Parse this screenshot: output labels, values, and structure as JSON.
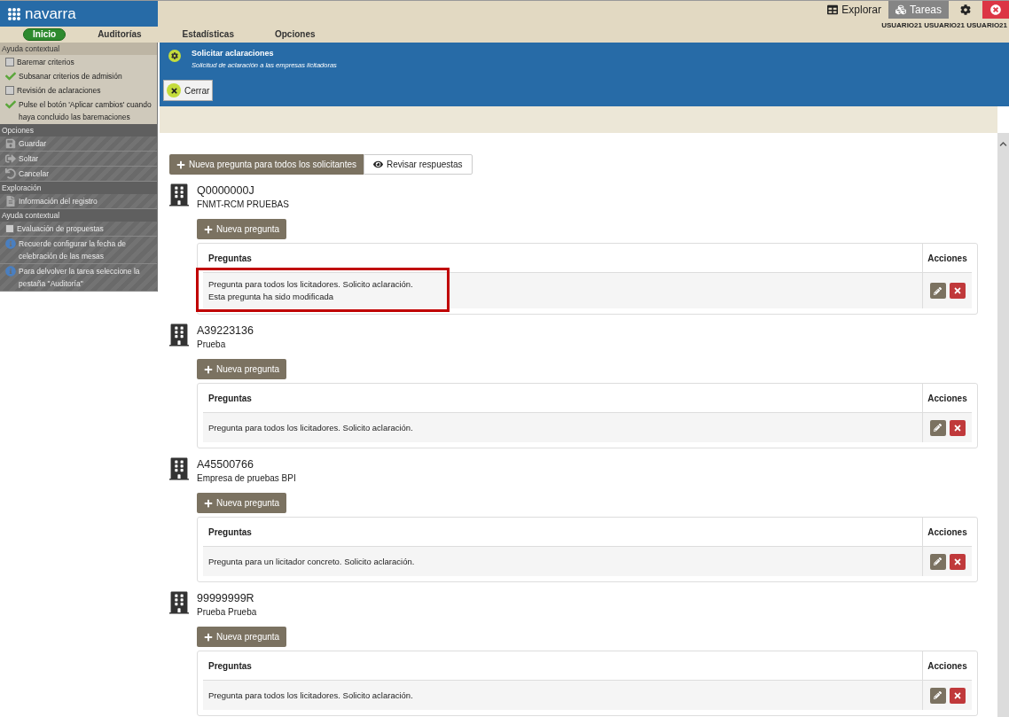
{
  "app": {
    "logo": "navarra"
  },
  "nav": [
    {
      "label": "Inicio",
      "selected": true
    },
    {
      "label": "Auditorías",
      "selected": false
    },
    {
      "label": "Estadísticas",
      "selected": false
    },
    {
      "label": "Opciones",
      "selected": false
    }
  ],
  "top_actions": [
    {
      "label": "Explorar",
      "kind": "explore",
      "selected": false
    },
    {
      "label": "Tareas",
      "kind": "tasks",
      "selected": true
    }
  ],
  "users": "USUARIO21 USUARIO21 USUARIO21",
  "sidebar": [
    {
      "title": "Ayuda contextual",
      "disabled": false,
      "items": [
        {
          "label": "Baremar criterios",
          "kind": "checkbox",
          "checked": false
        },
        {
          "label": "Subsanar criterios de admisión",
          "kind": "checkbox",
          "checked": true
        },
        {
          "label": "Revisión de aclaraciones",
          "kind": "checkbox",
          "checked": false
        },
        {
          "label": "Pulse el botón 'Aplicar cambios' cuando haya concluido las baremaciones",
          "kind": "checkbox",
          "checked": true
        }
      ]
    },
    {
      "title": "Opciones",
      "disabled": true,
      "items": [
        {
          "label": "Guardar",
          "kind": "save"
        },
        {
          "label": "Soltar",
          "kind": "release"
        },
        {
          "label": "Cancelar",
          "kind": "cancel"
        }
      ]
    },
    {
      "title": "Exploración",
      "disabled": true,
      "items": [
        {
          "label": "Información del registro",
          "kind": "document"
        }
      ]
    },
    {
      "title": "Ayuda contextual",
      "disabled": true,
      "items": [
        {
          "label": "Evaluación de propuestas",
          "kind": "checkbox",
          "checked": false
        },
        {
          "label": "Recuerde configurar la fecha de celebración de las mesas",
          "kind": "info"
        },
        {
          "label": "Para delvolver la tarea seleccione la pestaña \"Auditoría\"",
          "kind": "info"
        }
      ]
    }
  ],
  "dialog": {
    "title": "Solicitar aclaraciones",
    "subtitle": "Solicitud de aclaración a las empresas licitadoras",
    "close_label": "Cerrar"
  },
  "toolbar": {
    "new_question_all": "Nueva pregunta para todos los solicitantes",
    "review": "Revisar respuestas"
  },
  "companies": [
    {
      "id": "Q0000000J",
      "name": "FNMT-RCM PRUEBAS",
      "button": "Nueva pregunta",
      "columns": [
        "Preguntas",
        "Acciones"
      ],
      "rows": [
        {
          "lines": [
            "Pregunta para todos los licitadores. Solicito aclaración.",
            "Esta pregunta ha sido modificada"
          ],
          "highlighted": true
        }
      ]
    },
    {
      "id": "A39223136",
      "name": "Prueba",
      "button": "Nueva pregunta",
      "columns": [
        "Preguntas",
        "Acciones"
      ],
      "rows": [
        {
          "lines": [
            "Pregunta para todos los licitadores. Solicito aclaración."
          ],
          "highlighted": false
        }
      ]
    },
    {
      "id": "A45500766",
      "name": "Empresa de pruebas BPI",
      "button": "Nueva pregunta",
      "columns": [
        "Preguntas",
        "Acciones"
      ],
      "rows": [
        {
          "lines": [
            "Pregunta para un licitador concreto. Solicito aclaración."
          ],
          "highlighted": false
        }
      ]
    },
    {
      "id": "99999999R",
      "name": "Prueba Prueba",
      "button": "Nueva pregunta",
      "columns": [
        "Preguntas",
        "Acciones"
      ],
      "rows": [
        {
          "lines": [
            "Pregunta para todos los licitadores. Solicito aclaración."
          ],
          "highlighted": false
        }
      ]
    }
  ]
}
